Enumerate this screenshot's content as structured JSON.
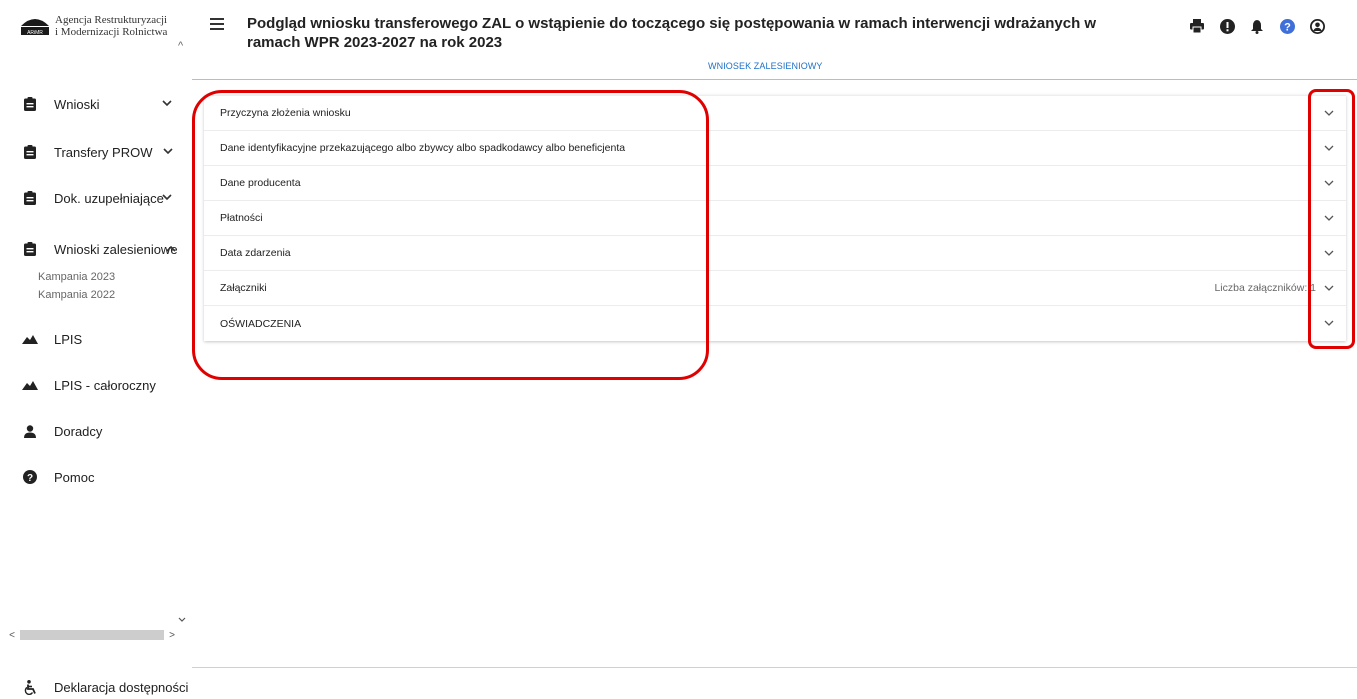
{
  "app": {
    "logo_line1": "Agencja Restrukturyzacji",
    "logo_line2": "i Modernizacji Rolnictwa",
    "logo_abbr": "ARiMR"
  },
  "sidebar": {
    "items": [
      {
        "label": "Wnioski",
        "icon": "clipboard-icon",
        "expanded": false
      },
      {
        "label": "Transfery PROW",
        "icon": "clipboard-icon",
        "expanded": false
      },
      {
        "label": "Dok. uzupełniające",
        "icon": "clipboard-icon",
        "expanded": false
      },
      {
        "label": "Wnioski zalesieniowe",
        "icon": "clipboard-icon",
        "expanded": true
      },
      {
        "label": "LPIS",
        "icon": "terrain-icon"
      },
      {
        "label": "LPIS - całoroczny",
        "icon": "terrain-icon"
      },
      {
        "label": "Doradcy",
        "icon": "person-icon"
      },
      {
        "label": "Pomoc",
        "icon": "help-circle-icon"
      }
    ],
    "subitems": [
      "Kampania 2023",
      "Kampania 2022"
    ],
    "accessibility_label": "Deklaracja dostępności"
  },
  "header": {
    "title": "Podgląd wniosku transferowego ZAL o wstąpienie do toczącego się postępowania w ramach interwencji wdrażanych w ramach WPR 2023-2027 na rok 2023",
    "tab": "WNIOSEK ZALESIENIOWY",
    "icons": [
      "print-icon",
      "alert-icon",
      "bell-icon",
      "help-icon",
      "account-icon"
    ]
  },
  "accordion": {
    "rows": [
      {
        "label": "Przyczyna złożenia wniosku",
        "right": ""
      },
      {
        "label": "Dane identyfikacyjne przekazującego albo zbywcy albo spadkodawcy albo beneficjenta",
        "right": ""
      },
      {
        "label": "Dane producenta",
        "right": ""
      },
      {
        "label": "Płatności",
        "right": ""
      },
      {
        "label": "Data zdarzenia",
        "right": ""
      },
      {
        "label": "Załączniki",
        "right": "Liczba załączników: 1"
      },
      {
        "label": "OŚWIADCZENIA",
        "right": ""
      }
    ]
  },
  "colors": {
    "accent": "#1e70c8",
    "annotation": "#e00000",
    "help_icon": "#3f6fd8"
  }
}
